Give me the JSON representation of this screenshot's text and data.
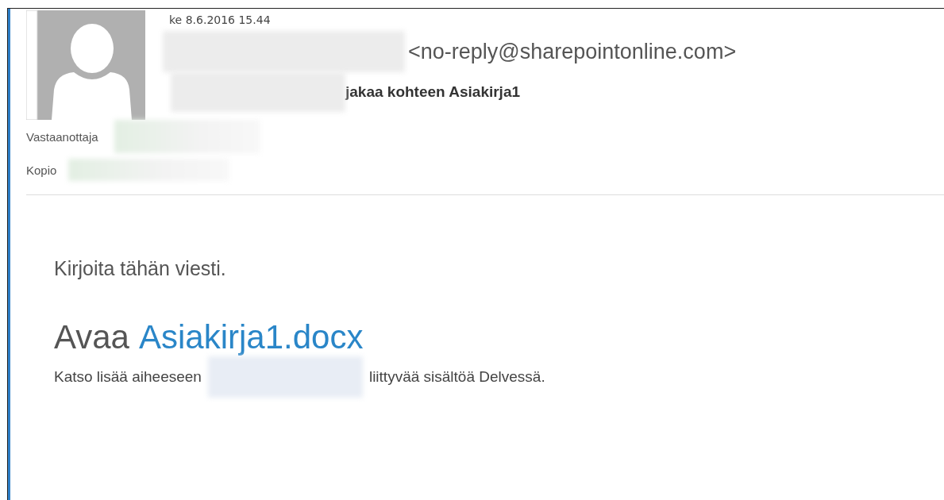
{
  "header": {
    "date": "ke 8.6.2016 15.44",
    "sender_address": "<no-reply@sharepointonline.com>",
    "subject": "jakaa kohteen Asiakirja1",
    "to_label": "Vastaanottaja",
    "cc_label": "Kopio"
  },
  "body": {
    "message": "Kirjoita tähän viesti.",
    "open_prefix": "Avaa",
    "open_link": "Asiakirja1.docx",
    "more_prefix": "Katso lisää aiheeseen",
    "more_suffix": "liittyvää sisältöä Delvessä."
  }
}
